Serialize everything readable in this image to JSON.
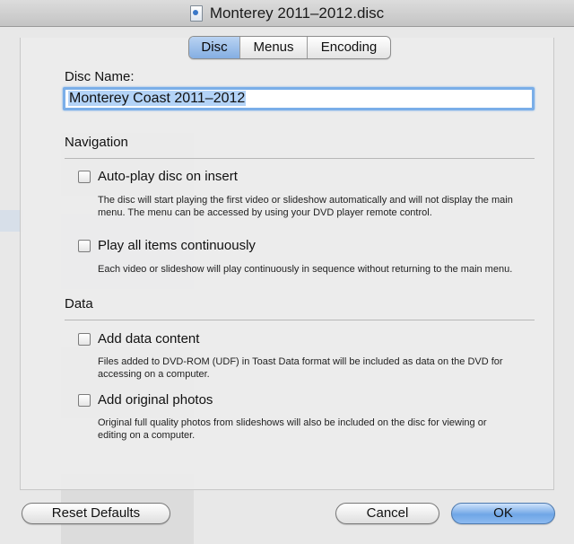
{
  "window": {
    "title": "Monterey 2011–2012.disc"
  },
  "tabs": [
    {
      "label": "Disc",
      "selected": true
    },
    {
      "label": "Menus",
      "selected": false
    },
    {
      "label": "Encoding",
      "selected": false
    }
  ],
  "disc_name": {
    "label": "Disc Name:",
    "value": "Monterey Coast 2011–2012"
  },
  "navigation": {
    "title": "Navigation",
    "autoplay": {
      "label": "Auto-play disc on insert",
      "checked": false,
      "desc1": "The disc will start playing the first video or slideshow automatically and will not display the main",
      "desc2": "menu. The menu can be accessed by using your DVD player remote control."
    },
    "playall": {
      "label": "Play all items continuously",
      "checked": false,
      "desc1": "Each video or slideshow will play continuously in sequence without returning to the main menu."
    }
  },
  "data": {
    "title": "Data",
    "add_data": {
      "label": "Add data content",
      "checked": false,
      "desc1": "Files added to DVD-ROM (UDF) in Toast Data format will be included as data on the DVD for",
      "desc2": "accessing on a computer."
    },
    "add_photos": {
      "label": "Add original photos",
      "checked": false,
      "desc1": "Original full quality photos from slideshows will also be included on the disc for viewing or",
      "desc2": "editing on a computer."
    }
  },
  "buttons": {
    "reset": "Reset Defaults",
    "cancel": "Cancel",
    "ok": "OK"
  },
  "colors": {
    "accent": "#7aaee8",
    "default_button": "#6fa6e6"
  }
}
